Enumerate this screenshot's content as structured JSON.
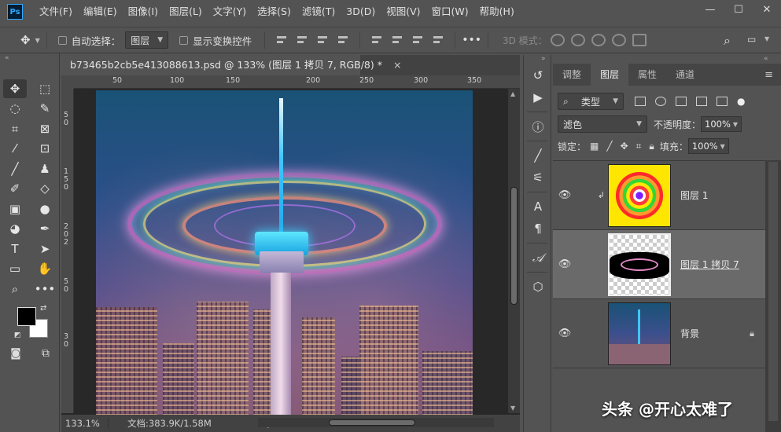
{
  "menu": {
    "logo": "Ps",
    "items": [
      "文件(F)",
      "编辑(E)",
      "图像(I)",
      "图层(L)",
      "文字(Y)",
      "选择(S)",
      "滤镜(T)",
      "3D(D)",
      "视图(V)",
      "窗口(W)",
      "帮助(H)"
    ]
  },
  "window_controls": {
    "minimize": "—",
    "maximize": "☐",
    "close": "✕"
  },
  "options": {
    "auto_select_label": "自动选择：",
    "auto_select_value": "图层",
    "show_transform_label": "显示变换控件",
    "more": "•••",
    "mode_3d_label": "3D 模式："
  },
  "document": {
    "tab_title": "b73465b2cb5e413088613.psd @ 133% (图层 1 拷贝 7, RGB/8) *",
    "tab_close": "×",
    "ruler_h": [
      "50",
      "100",
      "150",
      "200",
      "250",
      "300",
      "350"
    ],
    "ruler_v": [
      "5",
      "0",
      "1",
      "5",
      "0",
      "2",
      "0",
      "2",
      "5",
      "0",
      "3",
      "0"
    ],
    "zoom": "133.1%",
    "doc_info": "文档:383.9K/1.58M",
    "more": "❯"
  },
  "panel": {
    "tabs": [
      "调整",
      "图层",
      "属性",
      "通道"
    ],
    "active_tab": "图层",
    "menu_icon": "≡",
    "filter_kind": "类型",
    "blend_mode": "滤色",
    "opacity_label": "不透明度：",
    "opacity_value": "100%",
    "lock_label": "锁定：",
    "fill_label": "填充：",
    "fill_value": "100%"
  },
  "layers": [
    {
      "name": "图层 1",
      "visible": true,
      "clipped": true,
      "selected": false,
      "locked": false
    },
    {
      "name": "图层 1 拷贝 7",
      "visible": true,
      "clipped": false,
      "selected": true,
      "locked": false
    },
    {
      "name": "背景",
      "visible": true,
      "clipped": false,
      "selected": false,
      "locked": true
    }
  ],
  "watermark": "头条 @开心太难了",
  "colors": {
    "ui_bg": "#535353",
    "canvas_bg": "#282828",
    "foreground_swatch": "#000000",
    "background_swatch": "#ffffff",
    "selected_layer": "#6a6a6a"
  }
}
